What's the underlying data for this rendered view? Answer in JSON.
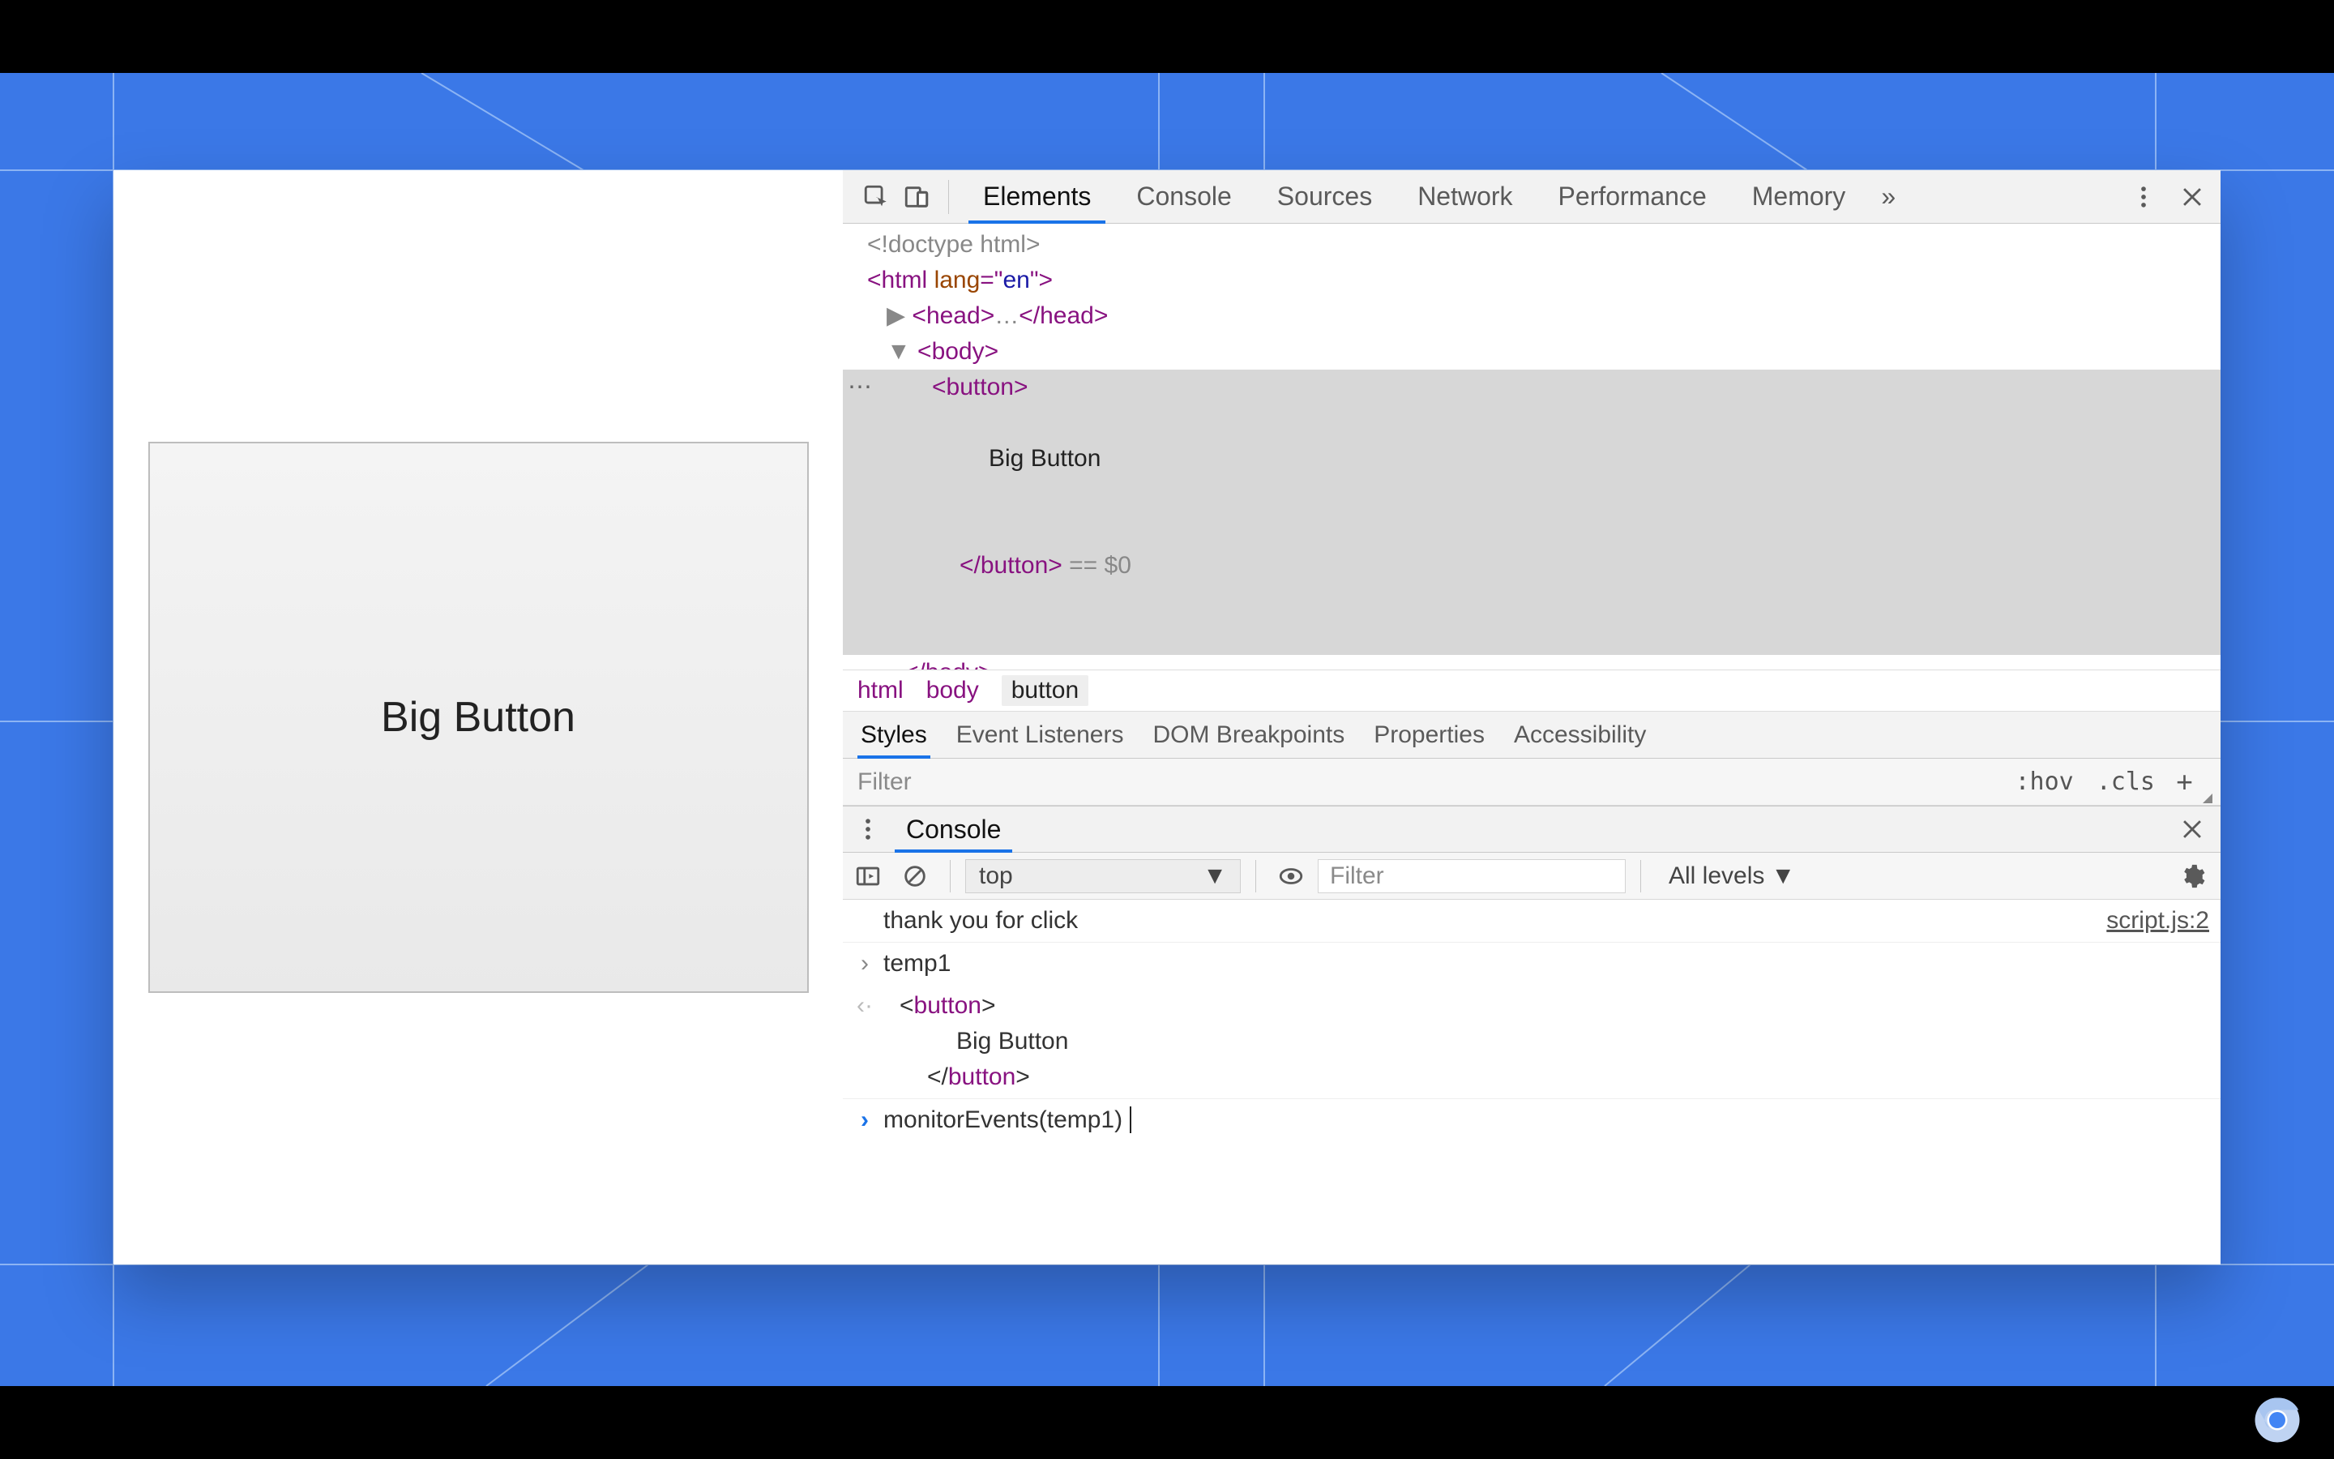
{
  "left": {
    "button_label": "Big Button"
  },
  "tabs": {
    "items": [
      "Elements",
      "Console",
      "Sources",
      "Network",
      "Performance",
      "Memory"
    ],
    "active_index": 0
  },
  "dom": {
    "doctype": "<!doctype html>",
    "html_open": "html",
    "html_attr_name": "lang",
    "html_attr_val": "en",
    "head_label": "head",
    "head_dots": "…",
    "body_label": "body",
    "button_label": "button",
    "button_text": "Big Button",
    "eq0": " == $0",
    "body_close": "body"
  },
  "breadcrumb": [
    "html",
    "body",
    "button"
  ],
  "subtabs": {
    "items": [
      "Styles",
      "Event Listeners",
      "DOM Breakpoints",
      "Properties",
      "Accessibility"
    ],
    "active_index": 0
  },
  "styles_filter": {
    "placeholder": "Filter",
    "hov": ":hov",
    "cls": ".cls"
  },
  "drawer": {
    "title": "Console"
  },
  "console_toolbar": {
    "context": "top",
    "filter_placeholder": "Filter",
    "levels": "All levels"
  },
  "console": {
    "log_msg": "thank you for click",
    "log_src": "script.js:2",
    "input1": "temp1",
    "out_button_open": "button",
    "out_button_text": "Big Button",
    "out_button_close": "button",
    "input2": "monitorEvents(temp1)"
  }
}
